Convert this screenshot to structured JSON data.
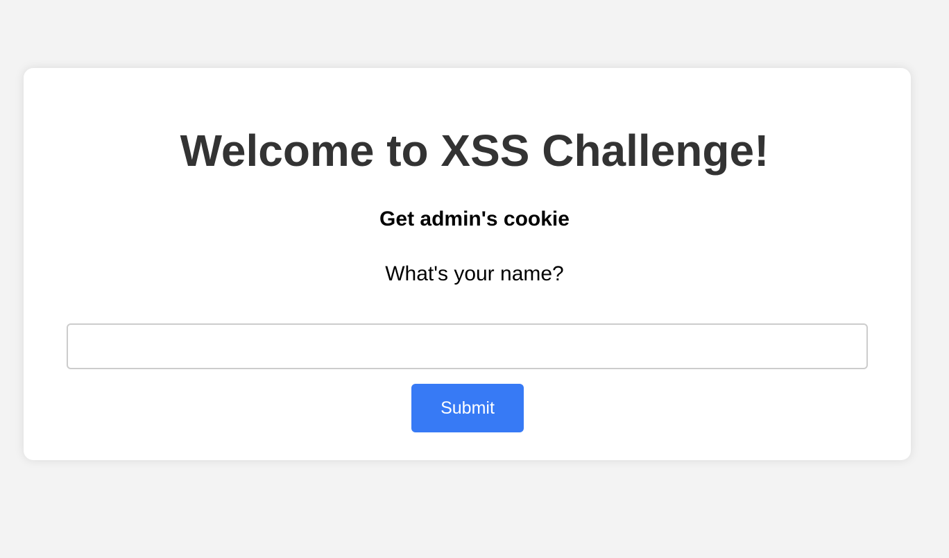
{
  "page": {
    "title": "Welcome to XSS Challenge!",
    "subtitle": "Get admin's cookie",
    "question": "What's your name?"
  },
  "form": {
    "name_value": "",
    "name_placeholder": "",
    "submit_label": "Submit"
  },
  "colors": {
    "background": "#f3f3f3",
    "button": "#377af5",
    "title": "#333333"
  }
}
